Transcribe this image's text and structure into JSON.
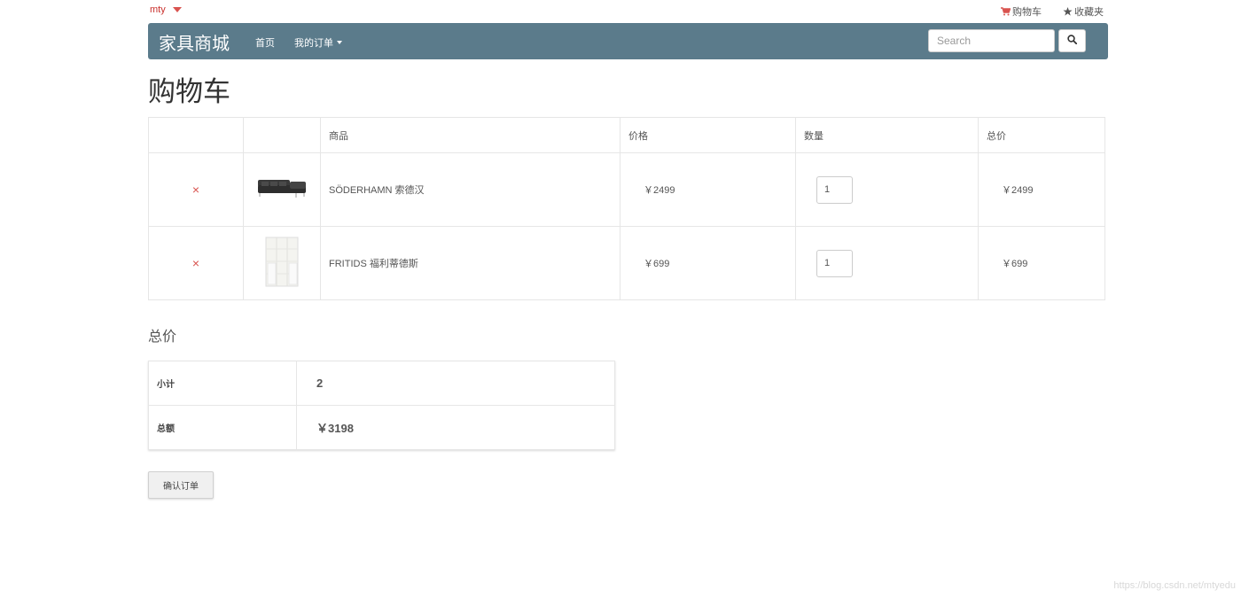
{
  "topbar": {
    "user": "mty",
    "cart_link": "购物车",
    "favorites_link": "收藏夹"
  },
  "navbar": {
    "brand": "家具商城",
    "home": "首页",
    "orders": "我的订单",
    "search_placeholder": "Search"
  },
  "page_title": "购物车",
  "cart": {
    "headers": [
      "",
      "",
      "商品",
      "价格",
      "数量",
      "总价"
    ],
    "items": [
      {
        "remove": "×",
        "image": "sofa-image",
        "name": "SÖDERHAMN 索德汉",
        "price": "￥2499",
        "quantity": "1",
        "subtotal": "￥2499"
      },
      {
        "remove": "×",
        "image": "bookcase-image",
        "name": "FRITIDS 福利蒂德斯",
        "price": "￥699",
        "quantity": "1",
        "subtotal": "￥699"
      }
    ]
  },
  "totals": {
    "heading": "总价",
    "subtotal_label": "小计",
    "subtotal_value": "2",
    "total_label": "总额",
    "total_value": "￥3198"
  },
  "confirm_button": "确认订单",
  "watermark": "https://blog.csdn.net/mtyedu",
  "colors": {
    "navbar": "#5b7b8b",
    "accent_red": "#d9534f"
  }
}
